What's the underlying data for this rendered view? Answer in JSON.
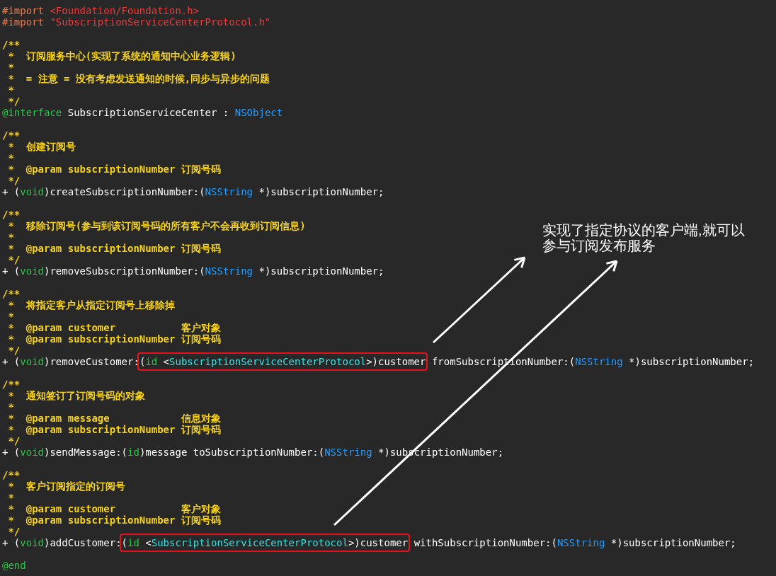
{
  "editor": {
    "blocks": [
      [
        [
          {
            "kind": "preprocessor",
            "text": "#import "
          },
          {
            "kind": "string",
            "text": "<Foundation/Foundation.h>"
          }
        ],
        [
          {
            "kind": "preprocessor",
            "text": "#import "
          },
          {
            "kind": "string",
            "text": "\"SubscriptionServiceCenterProtocol.h\""
          }
        ]
      ],
      [
        [
          {
            "kind": "comment",
            "text": "/**"
          }
        ],
        [
          {
            "kind": "comment",
            "text": " *  订阅服务中心(实现了系统的通知中心业务逻辑)"
          }
        ],
        [
          {
            "kind": "comment",
            "text": " *"
          }
        ],
        [
          {
            "kind": "comment",
            "text": " *  = 注意 = 没有考虑发送通知的时候,同步与异步的问题"
          }
        ],
        [
          {
            "kind": "comment",
            "text": " *"
          }
        ],
        [
          {
            "kind": "comment",
            "text": " */"
          }
        ],
        [
          {
            "kind": "keyword",
            "text": "@interface"
          },
          {
            "kind": "plain",
            "text": " SubscriptionServiceCenter : "
          },
          {
            "kind": "type",
            "text": "NSObject"
          }
        ]
      ],
      [
        [
          {
            "kind": "comment",
            "text": "/**"
          }
        ],
        [
          {
            "kind": "comment",
            "text": " *  创建订阅号"
          }
        ],
        [
          {
            "kind": "comment",
            "text": " *"
          }
        ],
        [
          {
            "kind": "comment",
            "text": " *  @param subscriptionNumber 订阅号码"
          }
        ],
        [
          {
            "kind": "comment",
            "text": " */"
          }
        ],
        [
          {
            "kind": "plain",
            "text": "+ ("
          },
          {
            "kind": "keyword",
            "text": "void"
          },
          {
            "kind": "plain",
            "text": ")createSubscriptionNumber:("
          },
          {
            "kind": "type",
            "text": "NSString"
          },
          {
            "kind": "plain",
            "text": " *)subscriptionNumber;"
          }
        ]
      ],
      [
        [
          {
            "kind": "comment",
            "text": "/**"
          }
        ],
        [
          {
            "kind": "comment",
            "text": " *  移除订阅号(参与到该订阅号码的所有客户不会再收到订阅信息)"
          }
        ],
        [
          {
            "kind": "comment",
            "text": " *"
          }
        ],
        [
          {
            "kind": "comment",
            "text": " *  @param subscriptionNumber 订阅号码"
          }
        ],
        [
          {
            "kind": "comment",
            "text": " */"
          }
        ],
        [
          {
            "kind": "plain",
            "text": "+ ("
          },
          {
            "kind": "keyword",
            "text": "void"
          },
          {
            "kind": "plain",
            "text": ")removeSubscriptionNumber:("
          },
          {
            "kind": "type",
            "text": "NSString"
          },
          {
            "kind": "plain",
            "text": " *)subscriptionNumber;"
          }
        ]
      ],
      [
        [
          {
            "kind": "comment",
            "text": "/**"
          }
        ],
        [
          {
            "kind": "comment",
            "text": " *  将指定客户从指定订阅号上移除掉"
          }
        ],
        [
          {
            "kind": "comment",
            "text": " *"
          }
        ],
        [
          {
            "kind": "comment",
            "text": " *  @param customer           客户对象"
          }
        ],
        [
          {
            "kind": "comment",
            "text": " *  @param subscriptionNumber 订阅号码"
          }
        ],
        [
          {
            "kind": "comment",
            "text": " */"
          }
        ],
        [
          {
            "kind": "plain",
            "text": "+ ("
          },
          {
            "kind": "keyword",
            "text": "void"
          },
          {
            "kind": "plain",
            "text": ")removeCustomer:"
          },
          {
            "kind": "box",
            "tokens": [
              {
                "kind": "plain",
                "text": "("
              },
              {
                "kind": "keyword",
                "text": "id"
              },
              {
                "kind": "plain",
                "text": " <"
              },
              {
                "kind": "protocol",
                "text": "SubscriptionServiceCenterProtocol"
              },
              {
                "kind": "plain",
                "text": ">)customer"
              }
            ]
          },
          {
            "kind": "plain",
            "text": " fromSubscriptionNumber:("
          },
          {
            "kind": "type",
            "text": "NSString"
          },
          {
            "kind": "plain",
            "text": " *)subscriptionNumber;"
          }
        ]
      ],
      [
        [
          {
            "kind": "comment",
            "text": "/**"
          }
        ],
        [
          {
            "kind": "comment",
            "text": " *  通知签订了订阅号码的对象"
          }
        ],
        [
          {
            "kind": "comment",
            "text": " *"
          }
        ],
        [
          {
            "kind": "comment",
            "text": " *  @param message            信息对象"
          }
        ],
        [
          {
            "kind": "comment",
            "text": " *  @param subscriptionNumber 订阅号码"
          }
        ],
        [
          {
            "kind": "comment",
            "text": " */"
          }
        ],
        [
          {
            "kind": "plain",
            "text": "+ ("
          },
          {
            "kind": "keyword",
            "text": "void"
          },
          {
            "kind": "plain",
            "text": ")sendMessage:("
          },
          {
            "kind": "keyword",
            "text": "id"
          },
          {
            "kind": "plain",
            "text": ")message toSubscriptionNumber:("
          },
          {
            "kind": "type",
            "text": "NSString"
          },
          {
            "kind": "plain",
            "text": " *)subscriptionNumber;"
          }
        ]
      ],
      [
        [
          {
            "kind": "comment",
            "text": "/**"
          }
        ],
        [
          {
            "kind": "comment",
            "text": " *  客户订阅指定的订阅号"
          }
        ],
        [
          {
            "kind": "comment",
            "text": " *"
          }
        ],
        [
          {
            "kind": "comment",
            "text": " *  @param customer           客户对象"
          }
        ],
        [
          {
            "kind": "comment",
            "text": " *  @param subscriptionNumber 订阅号码"
          }
        ],
        [
          {
            "kind": "comment",
            "text": " */"
          }
        ],
        [
          {
            "kind": "plain",
            "text": "+ ("
          },
          {
            "kind": "keyword",
            "text": "void"
          },
          {
            "kind": "plain",
            "text": ")addCustomer:"
          },
          {
            "kind": "box",
            "tokens": [
              {
                "kind": "plain",
                "text": "("
              },
              {
                "kind": "keyword",
                "text": "id"
              },
              {
                "kind": "plain",
                "text": " <"
              },
              {
                "kind": "protocol",
                "text": "SubscriptionServiceCenterProtocol"
              },
              {
                "kind": "plain",
                "text": ">)customer"
              }
            ]
          },
          {
            "kind": "plain",
            "text": " withSubscriptionNumber:("
          },
          {
            "kind": "type",
            "text": "NSString"
          },
          {
            "kind": "plain",
            "text": " *)subscriptionNumber;"
          }
        ]
      ],
      [
        [
          {
            "kind": "keyword",
            "text": "@end"
          }
        ]
      ]
    ]
  },
  "annotation": {
    "lines": [
      "实现了指定协议的客户端,就可以",
      "参与订阅发布服务"
    ]
  }
}
